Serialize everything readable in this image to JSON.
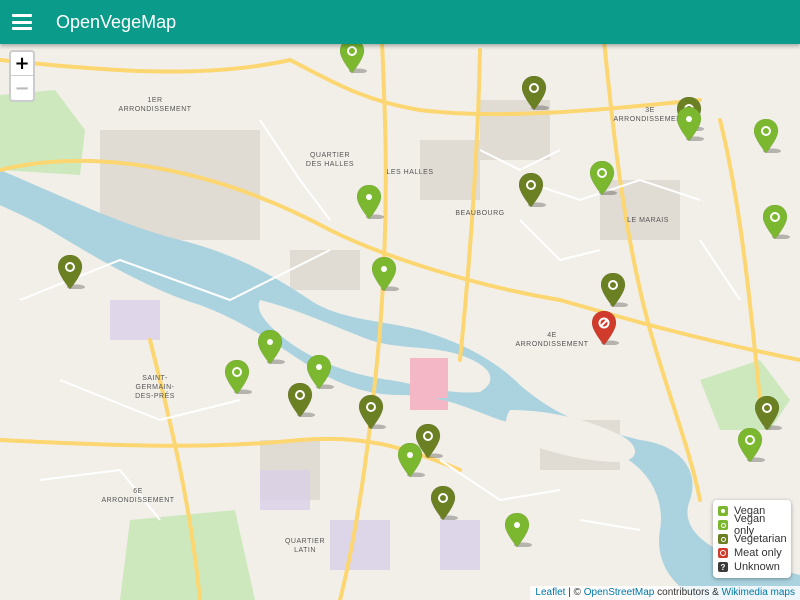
{
  "app": {
    "title": "OpenVegeMap"
  },
  "zoom": {
    "in_label": "+",
    "out_label": "−"
  },
  "colors": {
    "vegan": "#7cb82f",
    "vegan_only": "#7cb82f",
    "vegetarian": "#6b7f23",
    "meat_only": "#d13b2c",
    "unknown": "#3a3a3a",
    "appbar": "#0b9b8a"
  },
  "map": {
    "district_labels": [
      {
        "lines": [
          "1ER",
          "ARRONDISSEMENT"
        ]
      },
      {
        "lines": [
          "QUARTIER",
          "DES HALLES"
        ]
      },
      {
        "lines": [
          "LES HALLES"
        ]
      },
      {
        "lines": [
          "BEAUBOURG"
        ]
      },
      {
        "lines": [
          "3E",
          "ARRONDISSEMENT"
        ]
      },
      {
        "lines": [
          "LE MARAIS"
        ]
      },
      {
        "lines": [
          "4E",
          "ARRONDISSEMENT"
        ]
      },
      {
        "lines": [
          "SAINT-",
          "GERMAIN-",
          "DES-PRÉS"
        ]
      },
      {
        "lines": [
          "6E",
          "ARRONDISSEMENT"
        ]
      },
      {
        "lines": [
          "QUARTIER",
          "LATIN"
        ]
      }
    ],
    "markers": [
      {
        "type": "vegan_only"
      },
      {
        "type": "vegetarian"
      },
      {
        "type": "vegetarian"
      },
      {
        "type": "vegan"
      },
      {
        "type": "vegan_only"
      },
      {
        "type": "vegan_only"
      },
      {
        "type": "vegetarian"
      },
      {
        "type": "vegan"
      },
      {
        "type": "vegan_only"
      },
      {
        "type": "vegetarian"
      },
      {
        "type": "vegan"
      },
      {
        "type": "vegetarian"
      },
      {
        "type": "meat_only"
      },
      {
        "type": "vegan"
      },
      {
        "type": "vegan"
      },
      {
        "type": "vegan_only"
      },
      {
        "type": "vegetarian"
      },
      {
        "type": "vegetarian"
      },
      {
        "type": "vegetarian"
      },
      {
        "type": "vegan"
      },
      {
        "type": "vegetarian"
      },
      {
        "type": "vegan_only"
      },
      {
        "type": "vegetarian"
      },
      {
        "type": "vegan"
      }
    ]
  },
  "legend": {
    "items": [
      {
        "key": "vegan",
        "label": "Vegan"
      },
      {
        "key": "vegan_only",
        "label": "Vegan only"
      },
      {
        "key": "vegetarian",
        "label": "Vegetarian"
      },
      {
        "key": "meat_only",
        "label": "Meat only"
      },
      {
        "key": "unknown",
        "label": "Unknown"
      }
    ]
  },
  "attribution": {
    "leaflet": "Leaflet",
    "separator": "| ©",
    "osm": "OpenStreetMap",
    "contributors": "contributors &",
    "wikimedia": "Wikimedia maps"
  }
}
